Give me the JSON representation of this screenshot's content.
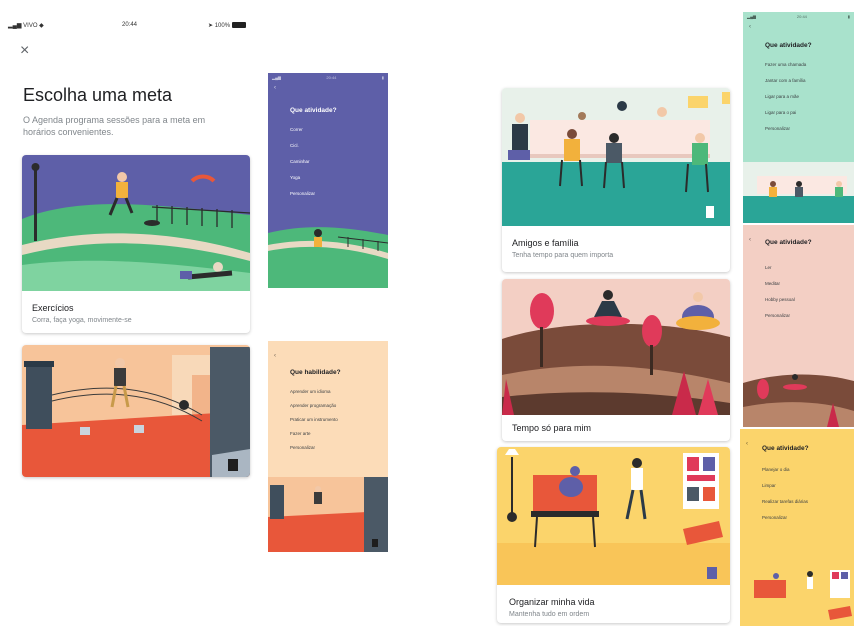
{
  "status_bar": {
    "carrier": "VIVO",
    "time": "20:44",
    "battery": "100%"
  },
  "close_label": "×",
  "page": {
    "title": "Escolha uma meta",
    "subtitle_line1": "O Agenda programa sessões para a meta em",
    "subtitle_line2": "horários convenientes."
  },
  "cards": [
    {
      "title": "Exercícios",
      "subtitle": "Corra, faça yoga, movimente-se"
    },
    {
      "title": "",
      "subtitle": ""
    },
    {
      "title": "Amigos e família",
      "subtitle": "Tenha tempo para quem importa"
    },
    {
      "title": "Tempo só para mim",
      "subtitle": ""
    },
    {
      "title": "Organizar minha vida",
      "subtitle": "Mantenha tudo em ordem"
    }
  ],
  "phones": [
    {
      "back": "‹",
      "question": "Que atividade?",
      "options": [
        "Correr",
        "Cicl.",
        "Caminhar",
        "Yoga",
        "Personalizar"
      ]
    },
    {
      "back": "‹",
      "question": "Que habilidade?",
      "options": [
        "Aprender um idioma",
        "Aprender programação",
        "Praticar um instrumento",
        "Fazer arte",
        "Personalizar"
      ]
    },
    {
      "back": "‹",
      "question": "Que atividade?",
      "options": [
        "Fazer uma chamada",
        "Jantar com a família",
        "Ligar para a mãe",
        "Ligar para o pai",
        "Personalizar"
      ]
    },
    {
      "back": "‹",
      "question": "Que atividade?",
      "options": [
        "Ler",
        "Meditar",
        "Hobby pessoal",
        "Personalizar"
      ]
    },
    {
      "back": "‹",
      "question": "Que atividade?",
      "options": [
        "Planejar o dia",
        "Limpar",
        "Realizar tarefas diárias",
        "Personalizar"
      ]
    }
  ],
  "colors": {
    "sky_purple": "#5e5fa8",
    "grass_green": "#4db87a",
    "path_beige": "#e8d9c4",
    "peach": "#f7c49a",
    "roof_red": "#e8573a",
    "teal": "#2aa597",
    "pink_bg": "#f3cfc4",
    "brown": "#7a4b3a",
    "yellow": "#fbd46b",
    "mint": "#a9e2cc"
  }
}
